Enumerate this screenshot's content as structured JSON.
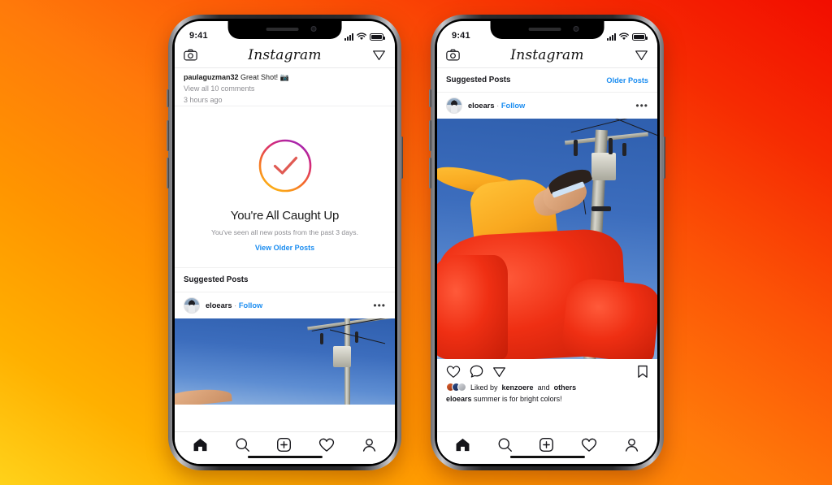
{
  "background": {
    "from": "#FFD21A",
    "mid": "#FF7A0A",
    "to": "#F20D00"
  },
  "accent": {
    "link": "#1a8cf0",
    "text": "#15151a",
    "muted": "#8e8e93"
  },
  "phones": [
    {
      "id": "left-phone",
      "status": {
        "time": "9:41",
        "signal_icon": "signal-bars-icon",
        "wifi_icon": "wifi-icon",
        "battery_icon": "battery-full-icon"
      },
      "header": {
        "camera_icon": "camera-icon",
        "logo": "Instagram",
        "direct_icon": "paper-plane-icon"
      },
      "previous_post": {
        "username": "paulaguzman32",
        "comment": "Great Shot!",
        "emoji": "📷",
        "view_comments": "View all 10 comments",
        "timestamp": "3 hours ago"
      },
      "caught_up": {
        "check_icon": "check-circle-gradient-icon",
        "title": "You're All Caught Up",
        "subtitle": "You've seen all new posts from the past 3 days.",
        "link": "View Older Posts"
      },
      "suggested": {
        "heading": "Suggested Posts",
        "post": {
          "avatar": "user-avatar",
          "username": "eloears",
          "separator": "·",
          "follow": "Follow",
          "more_icon": "more-options-icon"
        }
      },
      "tabbar": [
        {
          "name": "home",
          "icon": "home-icon-filled",
          "active": true
        },
        {
          "name": "search",
          "icon": "search-icon",
          "active": false
        },
        {
          "name": "create",
          "icon": "plus-square-icon",
          "active": false
        },
        {
          "name": "activity",
          "icon": "heart-icon",
          "active": false
        },
        {
          "name": "profile",
          "icon": "person-icon",
          "active": false
        }
      ]
    },
    {
      "id": "right-phone",
      "status": {
        "time": "9:41",
        "signal_icon": "signal-bars-icon",
        "wifi_icon": "wifi-icon",
        "battery_icon": "battery-full-icon"
      },
      "header": {
        "camera_icon": "camera-icon",
        "logo": "Instagram",
        "direct_icon": "paper-plane-icon"
      },
      "suggested": {
        "heading": "Suggested Posts",
        "older_link": "Older Posts",
        "post": {
          "avatar": "user-avatar",
          "username": "eloears",
          "separator": "·",
          "follow": "Follow",
          "more_icon": "more-options-icon"
        }
      },
      "photo": {
        "alt": "person-in-orange-shirt-and-red-overalls-leaning-by-utility-pole"
      },
      "actions": {
        "like_icon": "heart-icon",
        "comment_icon": "comment-bubble-icon",
        "share_icon": "paper-plane-icon",
        "save_icon": "bookmark-icon"
      },
      "engagement": {
        "liked_prefix": "Liked by",
        "liked_user": "kenzoere",
        "liked_mid": "and",
        "liked_suffix": "others"
      },
      "caption": {
        "username": "eloears",
        "text": "summer is for bright colors!"
      },
      "tabbar": [
        {
          "name": "home",
          "icon": "home-icon-filled",
          "active": true
        },
        {
          "name": "search",
          "icon": "search-icon",
          "active": false
        },
        {
          "name": "create",
          "icon": "plus-square-icon",
          "active": false
        },
        {
          "name": "activity",
          "icon": "heart-icon",
          "active": false
        },
        {
          "name": "profile",
          "icon": "person-icon",
          "active": false
        }
      ]
    }
  ]
}
